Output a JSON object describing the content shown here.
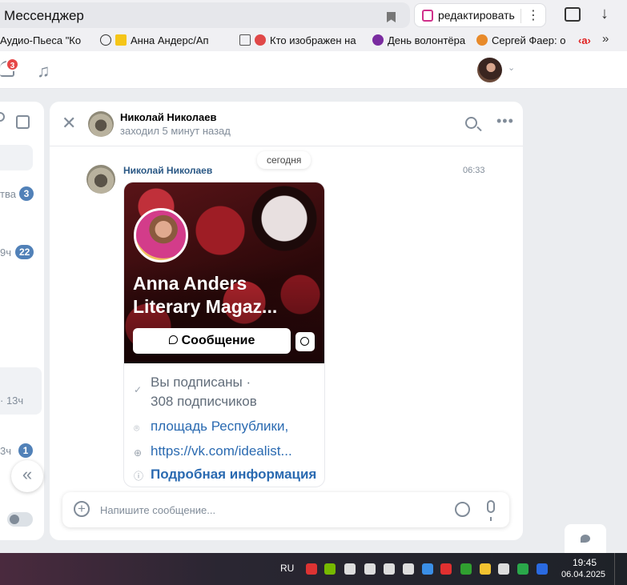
{
  "browser": {
    "address_text": "Мессенджер",
    "edit_label": "редактировать",
    "bookmarks": [
      {
        "label": "Аудио-Пьеса \"Ко",
        "color": "#f0f0f3"
      },
      {
        "label": "Анна Андерс/Ап",
        "color": "#f5c518"
      },
      {
        "label": "Кто изображен на",
        "color": "#e04848"
      },
      {
        "label": "День волонтёра",
        "color": "#7a2ca0"
      },
      {
        "label": "Сергей Фаер: о",
        "color": "#e88a2a"
      }
    ],
    "bookmarks_more": "»"
  },
  "header": {
    "notifications_count": "3",
    "chevron": "⌄"
  },
  "left_panel": {
    "items": [
      {
        "text": "тва",
        "badge": "3"
      },
      {
        "text": "9ч",
        "badge": "22"
      },
      {
        "text": "· 13ч",
        "badge": ""
      },
      {
        "text": "3ч",
        "badge": "1"
      }
    ],
    "collapse_icon": "«"
  },
  "chat": {
    "contact_name": "Николай Николаев",
    "contact_status": "заходил 5 минут назад",
    "date_separator": "сегодня",
    "message": {
      "author": "Николай Николаев",
      "time": "06:33"
    },
    "card": {
      "title_line1": "Anna Anders",
      "title_line2": "Literary Magaz...",
      "message_button": "Сообщение",
      "subscribed_line1": "Вы подписаны ·",
      "subscribed_line2": "308 подписчиков",
      "address": "площадь Республики,",
      "link": "https://vk.com/idealist...",
      "more_info": "Подробная информация"
    },
    "composer_placeholder": "Напишите сообщение..."
  },
  "taskbar": {
    "lang": "RU",
    "time": "19:45",
    "date": "06.04.2025",
    "tray_colors": [
      "#d33",
      "#76b900",
      "#ddd",
      "#ddd",
      "#ddd",
      "#ddd",
      "#3a8ee6",
      "#e03030",
      "#30a030",
      "#f2c230",
      "#ddd",
      "#2aa84a",
      "#2a6ae0"
    ]
  }
}
